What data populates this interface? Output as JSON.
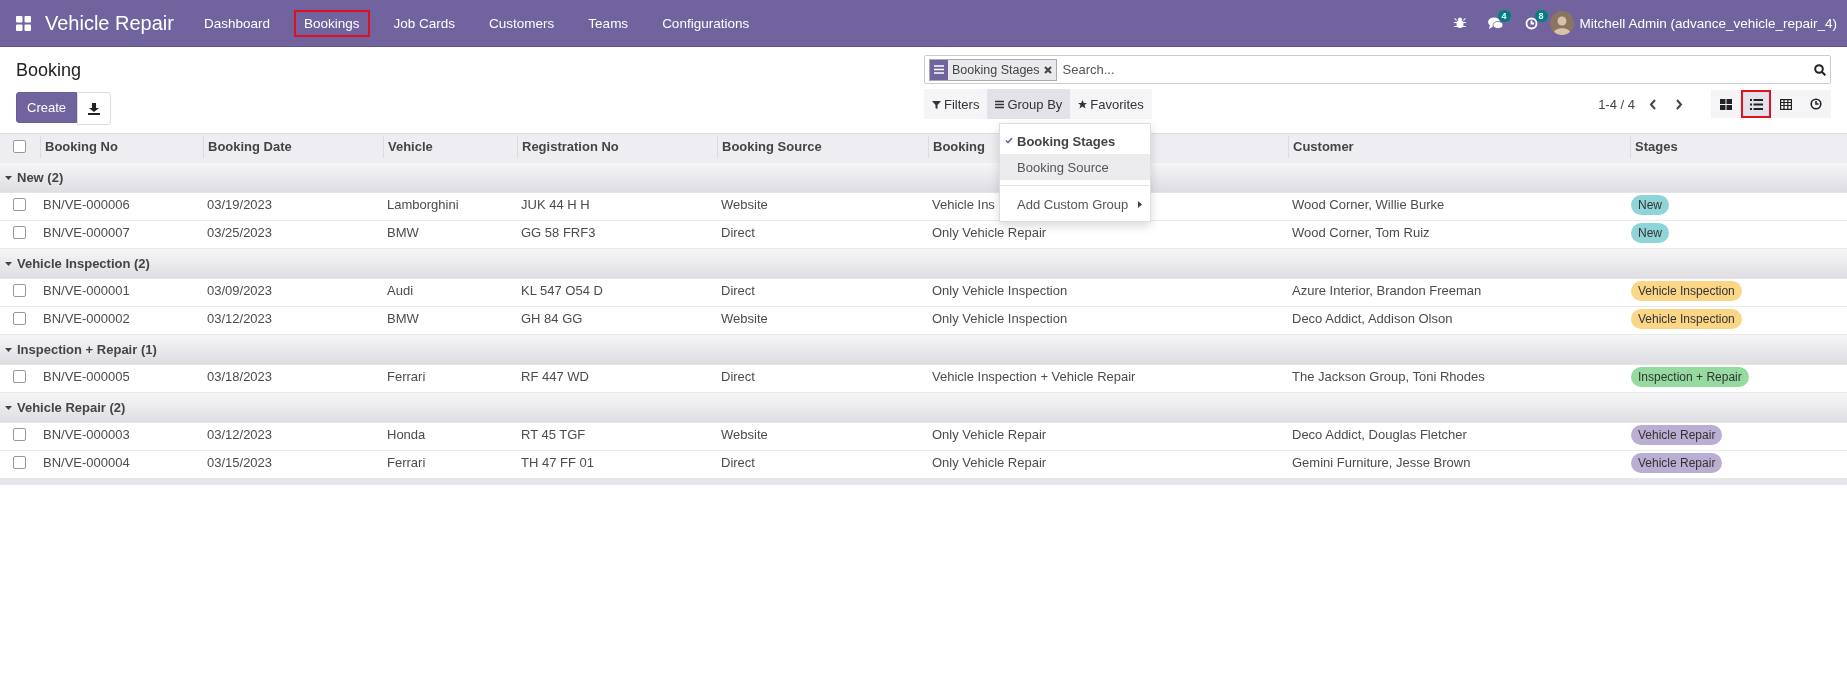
{
  "navbar": {
    "app_title": "Vehicle Repair",
    "menu": [
      {
        "label": "Dashboard",
        "annotated": false
      },
      {
        "label": "Bookings",
        "annotated": true
      },
      {
        "label": "Job Cards",
        "annotated": false
      },
      {
        "label": "Customers",
        "annotated": false
      },
      {
        "label": "Teams",
        "annotated": false
      },
      {
        "label": "Configurations",
        "annotated": false
      }
    ],
    "messages_count": "4",
    "activities_count": "8",
    "user": "Mitchell Admin (advance_vehicle_repair_4)"
  },
  "breadcrumb": "Booking",
  "create_button": "Create",
  "search": {
    "facet": "Booking Stages",
    "placeholder": "Search..."
  },
  "search_options": [
    {
      "kind": "filter",
      "label": "Filters",
      "open": false
    },
    {
      "kind": "group",
      "label": "Group By",
      "open": true
    },
    {
      "kind": "favorite",
      "label": "Favorites",
      "open": false
    }
  ],
  "group_by_menu": [
    {
      "kind": "option",
      "label": "Booking Stages",
      "checked": true,
      "highlighted": false
    },
    {
      "kind": "option",
      "label": "Booking Source",
      "checked": false,
      "highlighted": true
    },
    {
      "kind": "submenu",
      "label": "Add Custom Group",
      "checked": false,
      "highlighted": false
    }
  ],
  "pager": "1-4 / 4",
  "views": [
    {
      "kind": "kanban",
      "selected": false,
      "annotated": false
    },
    {
      "kind": "list",
      "selected": true,
      "annotated": true
    },
    {
      "kind": "pivot",
      "selected": false,
      "annotated": false
    },
    {
      "kind": "activity",
      "selected": false,
      "annotated": false
    }
  ],
  "table": {
    "select_all": false,
    "columns": [
      "Booking No",
      "Booking Date",
      "Vehicle",
      "Registration No",
      "Booking Source",
      "Booking",
      "Customer",
      "Stages"
    ],
    "groups": [
      {
        "label": "New (2)",
        "expanded": true,
        "rows": [
          {
            "checked": false,
            "cells": [
              "BN/VE-000006",
              "03/19/2023",
              "Lamborghini",
              "JUK 44 H H",
              "Website",
              "Vehicle Ins",
              "Wood Corner, Willie Burke"
            ],
            "stage": {
              "label": "New",
              "color": "#8fd4d9"
            }
          },
          {
            "checked": false,
            "cells": [
              "BN/VE-000007",
              "03/25/2023",
              "BMW",
              "GG 58 FRF3",
              "Direct",
              "Only Vehicle Repair",
              "Wood Corner, Tom Ruiz"
            ],
            "stage": {
              "label": "New",
              "color": "#8fd4d9"
            }
          }
        ]
      },
      {
        "label": "Vehicle Inspection (2)",
        "expanded": true,
        "rows": [
          {
            "checked": false,
            "cells": [
              "BN/VE-000001",
              "03/09/2023",
              "Audi",
              "KL 547 O54 D",
              "Direct",
              "Only Vehicle Inspection",
              "Azure Interior, Brandon Freeman"
            ],
            "stage": {
              "label": "Vehicle Inspection",
              "color": "#fcd687"
            }
          },
          {
            "checked": false,
            "cells": [
              "BN/VE-000002",
              "03/12/2023",
              "BMW",
              "GH 84 GG",
              "Website",
              "Only Vehicle Inspection",
              "Deco Addict, Addison Olson"
            ],
            "stage": {
              "label": "Vehicle Inspection",
              "color": "#fcd687"
            }
          }
        ]
      },
      {
        "label": "Inspection + Repair (1)",
        "expanded": true,
        "rows": [
          {
            "checked": false,
            "cells": [
              "BN/VE-000005",
              "03/18/2023",
              "Ferrari",
              "RF 447 WD",
              "Direct",
              "Vehicle Inspection + Vehicle Repair",
              "The Jackson Group, Toni Rhodes"
            ],
            "stage": {
              "label": "Inspection + Repair",
              "color": "#95dba0"
            }
          }
        ]
      },
      {
        "label": "Vehicle Repair (2)",
        "expanded": true,
        "rows": [
          {
            "checked": false,
            "cells": [
              "BN/VE-000003",
              "03/12/2023",
              "Honda",
              "RT 45 TGF",
              "Website",
              "Only Vehicle Repair",
              "Deco Addict, Douglas Fletcher"
            ],
            "stage": {
              "label": "Vehicle Repair",
              "color": "#bbaed3"
            }
          },
          {
            "checked": false,
            "cells": [
              "BN/VE-000004",
              "03/15/2023",
              "Ferrari",
              "TH 47 FF 01",
              "Direct",
              "Only Vehicle Repair",
              "Gemini Furniture, Jesse Brown"
            ],
            "stage": {
              "label": "Vehicle Repair",
              "color": "#bbaed3"
            }
          }
        ]
      }
    ]
  }
}
